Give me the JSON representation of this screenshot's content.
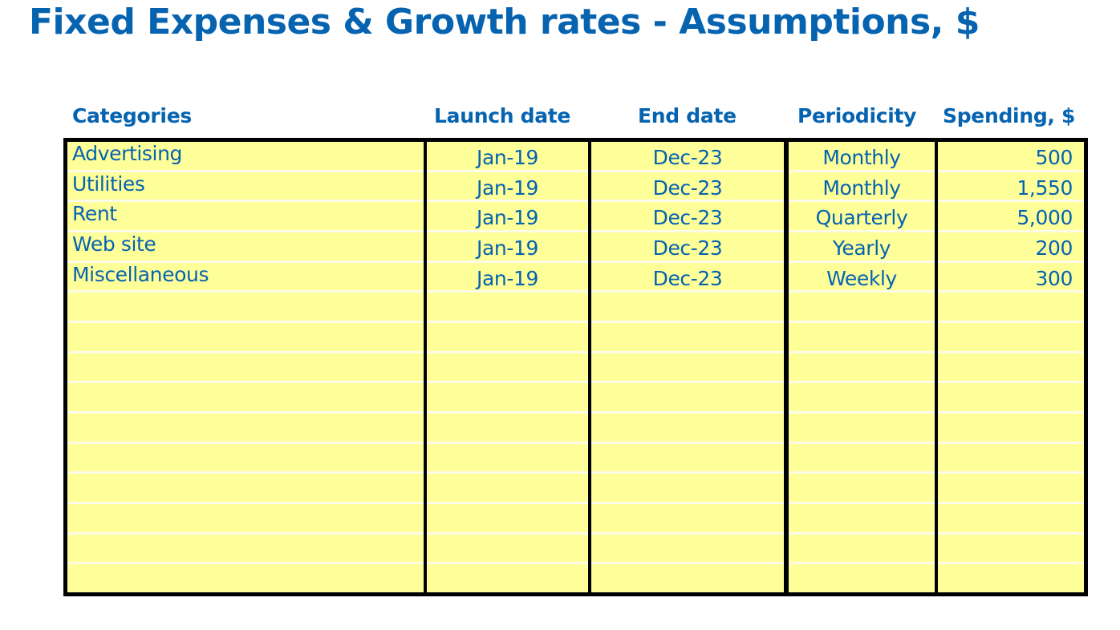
{
  "title": "Fixed Expenses & Growth rates - Assumptions, $",
  "table": {
    "headers": {
      "category": "Categories",
      "launch": "Launch date",
      "end": "End date",
      "periodicity": "Periodicity",
      "spending": "Spending, $"
    },
    "rows": [
      {
        "category": "Advertising",
        "launch": "Jan-19",
        "end": "Dec-23",
        "periodicity": "Monthly",
        "spending": "500"
      },
      {
        "category": "Utilities",
        "launch": "Jan-19",
        "end": "Dec-23",
        "periodicity": "Monthly",
        "spending": "1,550"
      },
      {
        "category": "Rent",
        "launch": "Jan-19",
        "end": "Dec-23",
        "periodicity": "Quarterly",
        "spending": "5,000"
      },
      {
        "category": "Web site",
        "launch": "Jan-19",
        "end": "Dec-23",
        "periodicity": "Yearly",
        "spending": "200"
      },
      {
        "category": "Miscellaneous",
        "launch": "Jan-19",
        "end": "Dec-23",
        "periodicity": "Weekly",
        "spending": "300"
      },
      {
        "category": "",
        "launch": "",
        "end": "",
        "periodicity": "",
        "spending": ""
      },
      {
        "category": "",
        "launch": "",
        "end": "",
        "periodicity": "",
        "spending": ""
      },
      {
        "category": "",
        "launch": "",
        "end": "",
        "periodicity": "",
        "spending": ""
      },
      {
        "category": "",
        "launch": "",
        "end": "",
        "periodicity": "",
        "spending": ""
      },
      {
        "category": "",
        "launch": "",
        "end": "",
        "periodicity": "",
        "spending": ""
      },
      {
        "category": "",
        "launch": "",
        "end": "",
        "periodicity": "",
        "spending": ""
      },
      {
        "category": "",
        "launch": "",
        "end": "",
        "periodicity": "",
        "spending": ""
      },
      {
        "category": "",
        "launch": "",
        "end": "",
        "periodicity": "",
        "spending": ""
      },
      {
        "category": "",
        "launch": "",
        "end": "",
        "periodicity": "",
        "spending": ""
      },
      {
        "category": "",
        "launch": "",
        "end": "",
        "periodicity": "",
        "spending": ""
      }
    ]
  },
  "colors": {
    "text": "#0563B0",
    "cell_fill": "#FFFF99",
    "border": "#000000"
  }
}
